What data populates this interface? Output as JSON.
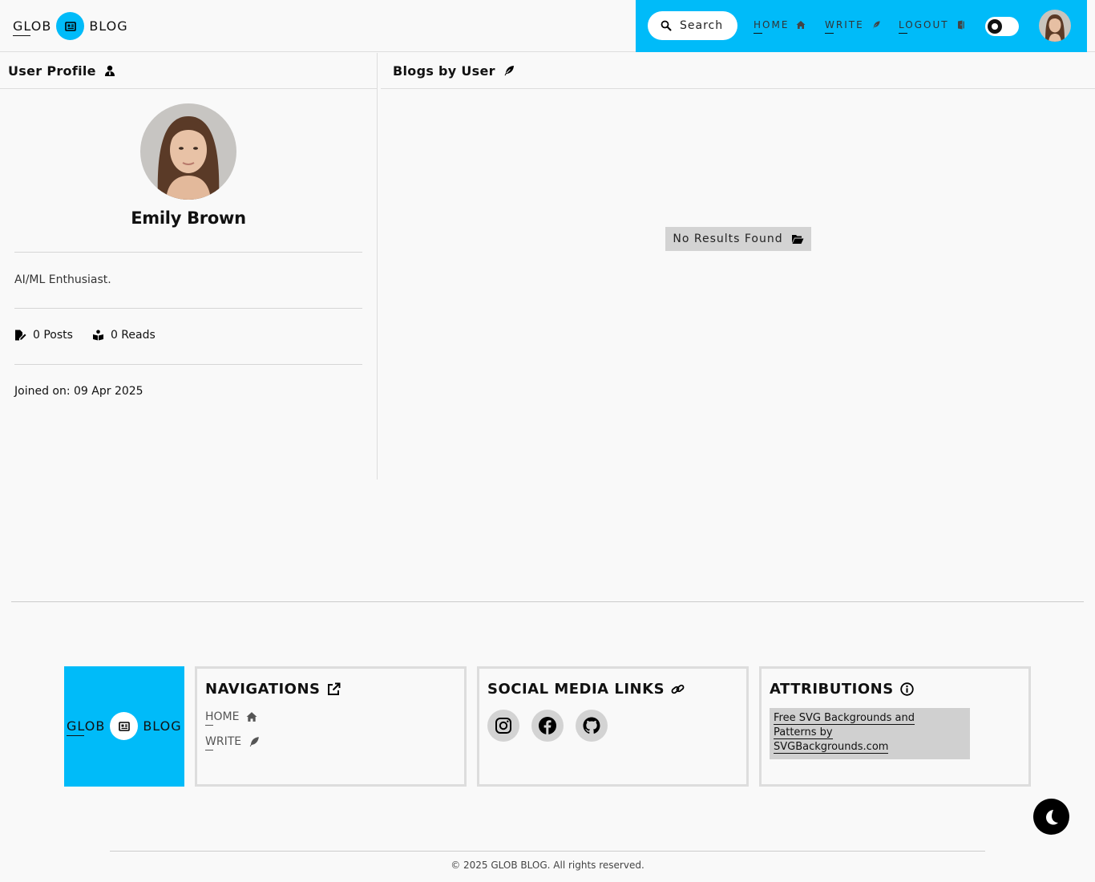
{
  "brand": {
    "word1": "GLOB",
    "word2": "BLOG",
    "icon": "newspaper-icon",
    "accent": "#00bbf9"
  },
  "header": {
    "search_label": "Search",
    "nav": [
      {
        "label": "HOME",
        "icon": "home-icon"
      },
      {
        "label": "WRITE",
        "icon": "feather-icon"
      },
      {
        "label": "LOGOUT",
        "icon": "door-icon"
      }
    ],
    "theme_toggle": "light",
    "avatar": "user-avatar"
  },
  "profile": {
    "title": "User Profile",
    "name": "Emily Brown",
    "bio": "AI/ML Enthusiast.",
    "posts": "0 Posts",
    "reads": "0 Reads",
    "joined": "Joined on: 09 Apr 2025"
  },
  "blogs": {
    "title": "Blogs by User",
    "empty_message": "No Results Found"
  },
  "footer": {
    "navigations": {
      "title": "NAVIGATIONS",
      "links": [
        {
          "label": "HOME",
          "icon": "home-icon"
        },
        {
          "label": "WRITE",
          "icon": "feather-icon"
        }
      ]
    },
    "social": {
      "title": "SOCIAL MEDIA LINKS",
      "links": [
        "instagram-icon",
        "facebook-icon",
        "github-icon"
      ]
    },
    "attributions": {
      "title": "ATTRIBUTIONS",
      "line1": "Free SVG Backgrounds and",
      "line2": "Patterns by",
      "line3": "SVGBackgrounds.com"
    },
    "copyright": "© 2025 GLOB BLOG. All rights reserved."
  }
}
